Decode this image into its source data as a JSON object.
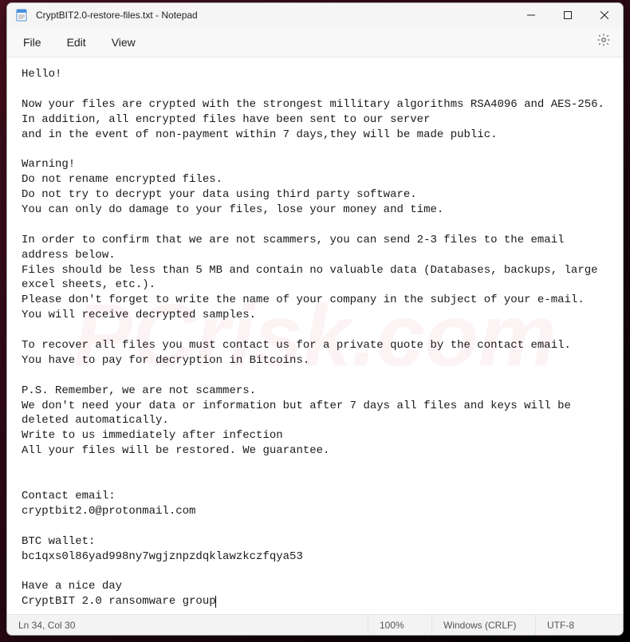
{
  "titlebar": {
    "title": "CryptBIT2.0-restore-files.txt - Notepad"
  },
  "menubar": {
    "file": "File",
    "edit": "Edit",
    "view": "View"
  },
  "document": {
    "text": "Hello!\n\nNow your files are crypted with the strongest millitary algorithms RSA4096 and AES-256.\nIn addition, all encrypted files have been sent to our server\nand in the event of non-payment within 7 days,they will be made public.\n\nWarning!\nDo not rename encrypted files.\nDo not try to decrypt your data using third party software.\nYou can only do damage to your files, lose your money and time.\n\nIn order to confirm that we are not scammers, you can send 2-3 files to the email address below.\nFiles should be less than 5 MB and contain no valuable data (Databases, backups, large excel sheets, etc.).\nPlease don't forget to write the name of your company in the subject of your e-mail.\nYou will receive decrypted samples.\n\nTo recover all files you must contact us for a private quote by the contact email.\nYou have to pay for decryption in Bitcoins.\n\nP.S. Remember, we are not scammers.\nWe don't need your data or information but after 7 days all files and keys will be deleted automatically.\nWrite to us immediately after infection\nAll your files will be restored. We guarantee.\n\n\nContact email:\ncryptbit2.0@protonmail.com\n\nBTC wallet:\nbc1qxs0l86yad998ny7wgjznpzdqklawzkczfqya53\n\nHave a nice day\nCryptBIT 2.0 ransomware group"
  },
  "statusbar": {
    "position": "Ln 34, Col 30",
    "zoom": "100%",
    "line_ending": "Windows (CRLF)",
    "encoding": "UTF-8"
  },
  "watermark": "PCrisk.com"
}
